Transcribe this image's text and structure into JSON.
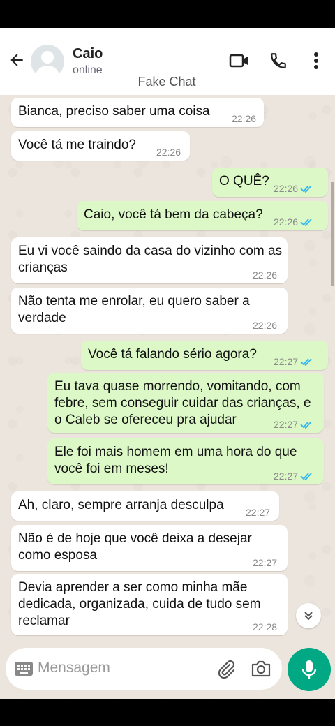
{
  "header": {
    "contact_name": "Caio",
    "contact_status": "online",
    "watermark": "Fake Chat"
  },
  "messages": [
    {
      "dir": "in",
      "text": "Bianca, preciso saber uma coisa",
      "time": "22:26"
    },
    {
      "dir": "in",
      "text": "Você tá me traindo?",
      "time": "22:26"
    },
    {
      "dir": "out",
      "text": "O QUÊ?",
      "time": "22:26",
      "read": true
    },
    {
      "dir": "out",
      "text": "Caio, você tá bem da cabeça?",
      "time": "22:26",
      "read": true
    },
    {
      "dir": "in",
      "text": "Eu vi você saindo da casa do vizinho com as crianças",
      "time": "22:26"
    },
    {
      "dir": "in",
      "text": "Não tenta me enrolar, eu quero saber a verdade",
      "time": "22:26"
    },
    {
      "dir": "out",
      "text": "Você tá falando sério agora?",
      "time": "22:27",
      "read": true
    },
    {
      "dir": "out",
      "text": "Eu tava quase morrendo, vomitando, com febre, sem conseguir cuidar das crianças, e o Caleb se ofereceu pra ajudar",
      "time": "22:27",
      "read": true
    },
    {
      "dir": "out",
      "text": "Ele foi mais homem em uma hora do que você foi em meses!",
      "time": "22:27",
      "read": true
    },
    {
      "dir": "in",
      "text": "Ah, claro, sempre arranja desculpa",
      "time": "22:27"
    },
    {
      "dir": "in",
      "text": "Não é de hoje que você deixa a desejar como esposa",
      "time": "22:27"
    },
    {
      "dir": "in",
      "text": "Devia aprender a ser como minha mãe dedicada, organizada, cuida de tudo sem reclamar",
      "time": "22:28"
    }
  ],
  "composer": {
    "placeholder": "Mensagem"
  },
  "colors": {
    "incoming_bubble": "#ffffff",
    "outgoing_bubble": "#dcf8c6",
    "read_ticks": "#34b7f1",
    "mic_button": "#00a884",
    "chat_background": "#ece5dd"
  }
}
